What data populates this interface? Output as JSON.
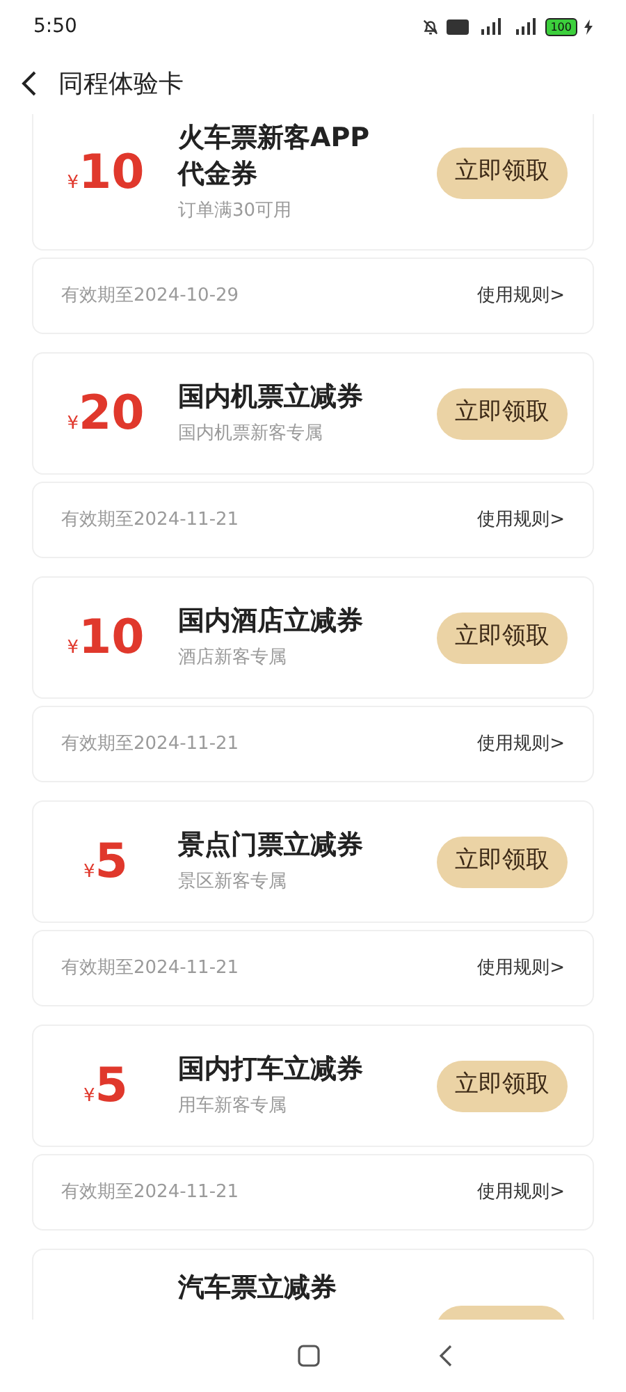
{
  "status_bar": {
    "time": "5:50",
    "battery": "100"
  },
  "header": {
    "title": "同程体验卡"
  },
  "coupons": [
    {
      "currency": "¥",
      "amount": "10",
      "title": "火车票新客APP代金券",
      "subtitle": "订单满30可用",
      "validity": "有效期至2024-10-29",
      "rules": "使用规则>",
      "button": "立即领取"
    },
    {
      "currency": "¥",
      "amount": "20",
      "title": "国内机票立减券",
      "subtitle": "国内机票新客专属",
      "validity": "有效期至2024-11-21",
      "rules": "使用规则>",
      "button": "立即领取"
    },
    {
      "currency": "¥",
      "amount": "10",
      "title": "国内酒店立减券",
      "subtitle": "酒店新客专属",
      "validity": "有效期至2024-11-21",
      "rules": "使用规则>",
      "button": "立即领取"
    },
    {
      "currency": "¥",
      "amount": "5",
      "title": "景点门票立减券",
      "subtitle": "景区新客专属",
      "validity": "有效期至2024-11-21",
      "rules": "使用规则>",
      "button": "立即领取"
    },
    {
      "currency": "¥",
      "amount": "5",
      "title": "国内打车立减券",
      "subtitle": "用车新客专属",
      "validity": "有效期至2024-11-21",
      "rules": "使用规则>",
      "button": "立即领取"
    },
    {
      "title": "汽车票立减券"
    }
  ]
}
